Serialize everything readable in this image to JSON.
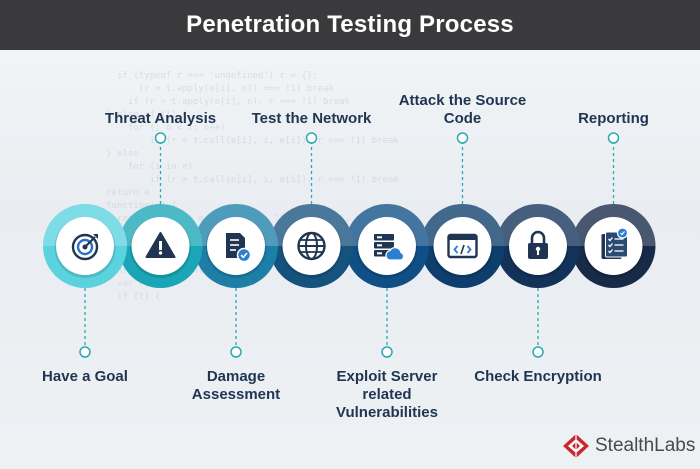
{
  "title": "Penetration Testing Process",
  "colors": {
    "title_bar": "#3a3a3c",
    "label_text": "#1f3552",
    "connector": "#2ba8b8",
    "logo_red": "#c8282e"
  },
  "steps": [
    {
      "label": "Have a Goal",
      "position": "below",
      "icon": "target-icon",
      "color": "#5ad3df"
    },
    {
      "label": "Threat Analysis",
      "position": "above",
      "icon": "warning-icon",
      "color": "#1aa6b7"
    },
    {
      "label": "Damage Assessment",
      "position": "below",
      "icon": "document-check-icon",
      "color": "#1d7fa8"
    },
    {
      "label": "Test the Network",
      "position": "above",
      "icon": "globe-icon",
      "color": "#16527e"
    },
    {
      "label": "Exploit Server related Vulnerabilities",
      "position": "below",
      "icon": "server-cloud-icon",
      "color": "#0f4f86"
    },
    {
      "label": "Attack the Source Code",
      "position": "above",
      "icon": "code-window-icon",
      "color": "#0d3e6c"
    },
    {
      "label": "Check Encryption",
      "position": "below",
      "icon": "lock-icon",
      "color": "#12325a"
    },
    {
      "label": "Reporting",
      "position": "above",
      "icon": "report-icon",
      "color": "#172a48"
    }
  ],
  "logo": {
    "text": "StealthLabs",
    "icon": "stealthlabs-logo-icon"
  }
}
